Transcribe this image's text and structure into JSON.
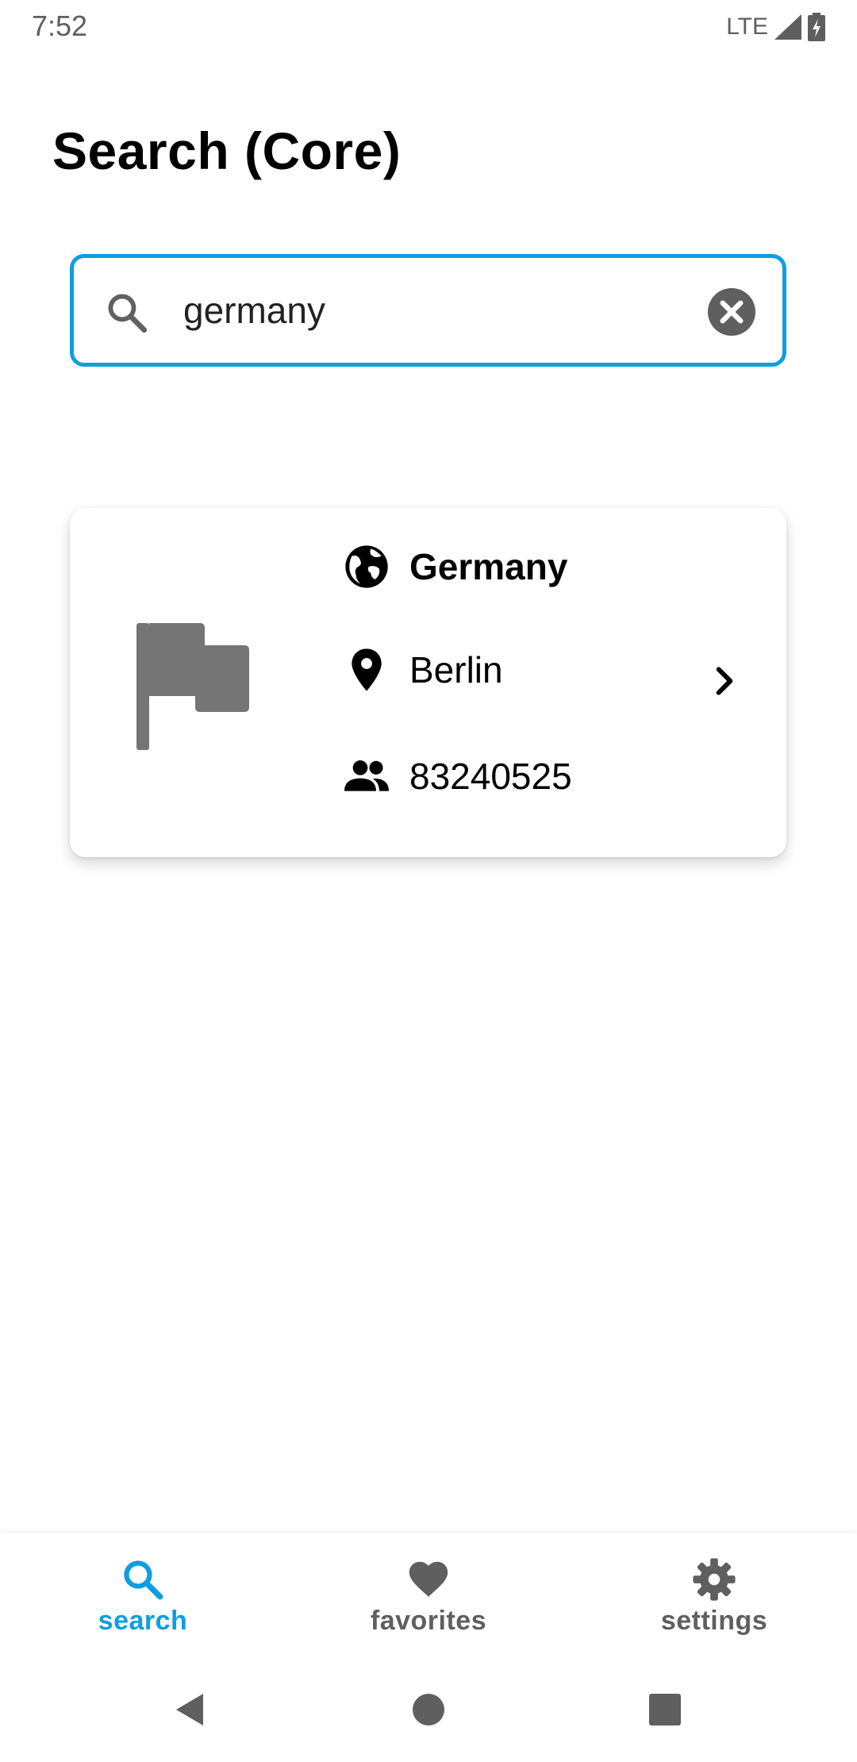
{
  "status_bar": {
    "time": "7:52",
    "network": "LTE",
    "icons": [
      "signal-icon",
      "battery-charging-icon"
    ]
  },
  "page": {
    "title": "Search (Core)"
  },
  "search": {
    "value": "germany",
    "icons": [
      "search-icon",
      "clear-icon"
    ]
  },
  "result": {
    "country": "Germany",
    "capital": "Berlin",
    "population": "83240525",
    "icons": [
      "flag-icon",
      "globe-icon",
      "location-pin-icon",
      "people-icon",
      "chevron-right-icon"
    ]
  },
  "bottom_nav": {
    "items": [
      {
        "label": "search",
        "icon": "search-icon",
        "active": true
      },
      {
        "label": "favorites",
        "icon": "heart-icon",
        "active": false
      },
      {
        "label": "settings",
        "icon": "gear-icon",
        "active": false
      }
    ]
  },
  "colors": {
    "accent": "#0d9ee0",
    "inactive": "#5f5f5f",
    "flag": "#757575"
  }
}
